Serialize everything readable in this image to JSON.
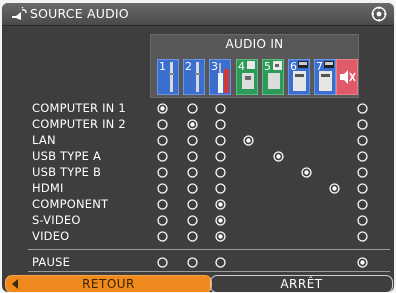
{
  "window": {
    "title": "SOURCE AUDIO",
    "title_icon": "speaker-icon",
    "corner_icon": "settings-icon"
  },
  "header": {
    "label": "AUDIO IN",
    "sources": [
      {
        "number": "1",
        "icon": "audio-jack-icon",
        "color": "#3a6fd0"
      },
      {
        "number": "2",
        "icon": "audio-jack-icon",
        "color": "#3a6fd0"
      },
      {
        "number": "3",
        "icon": "rca-plug-icon",
        "color": "#3a6fd0"
      },
      {
        "number": "4",
        "icon": "usb-a-icon",
        "color": "#2e9a58"
      },
      {
        "number": "5",
        "icon": "usb-b-icon",
        "color": "#2e9a58"
      },
      {
        "number": "6",
        "icon": "hdmi-icon",
        "color": "#3a6fd0"
      },
      {
        "number": "7",
        "icon": "hdmi-icon",
        "color": "#3a6fd0"
      },
      {
        "number": "",
        "icon": "mute-icon",
        "color": "#e05a6a"
      }
    ]
  },
  "rows": [
    {
      "label": "COMPUTER IN 1",
      "radios": [
        true,
        false,
        false,
        null,
        null,
        null,
        null,
        false
      ]
    },
    {
      "label": "COMPUTER IN 2",
      "radios": [
        false,
        true,
        false,
        null,
        null,
        null,
        null,
        false
      ]
    },
    {
      "label": "LAN",
      "radios": [
        false,
        false,
        false,
        true,
        null,
        null,
        null,
        false
      ]
    },
    {
      "label": "USB TYPE A",
      "radios": [
        false,
        false,
        false,
        null,
        true,
        null,
        null,
        false
      ]
    },
    {
      "label": "USB TYPE B",
      "radios": [
        false,
        false,
        false,
        null,
        null,
        true,
        null,
        false
      ]
    },
    {
      "label": "HDMI",
      "radios": [
        false,
        false,
        false,
        null,
        null,
        null,
        true,
        false
      ]
    },
    {
      "label": "COMPONENT",
      "radios": [
        false,
        false,
        true,
        null,
        null,
        null,
        null,
        false
      ]
    },
    {
      "label": "S-VIDEO",
      "radios": [
        false,
        false,
        true,
        null,
        null,
        null,
        null,
        false
      ]
    },
    {
      "label": "VIDEO",
      "radios": [
        false,
        false,
        true,
        null,
        null,
        null,
        null,
        false
      ]
    },
    {
      "label": "PAUSE",
      "radios": [
        false,
        false,
        false,
        null,
        null,
        null,
        null,
        true
      ]
    }
  ],
  "buttons": {
    "back_label": "RETOUR",
    "stop_label": "ARRÊT"
  },
  "colors": {
    "background": "#3e3e3e",
    "accent": "#f08a1e",
    "text": "#ffffff"
  }
}
